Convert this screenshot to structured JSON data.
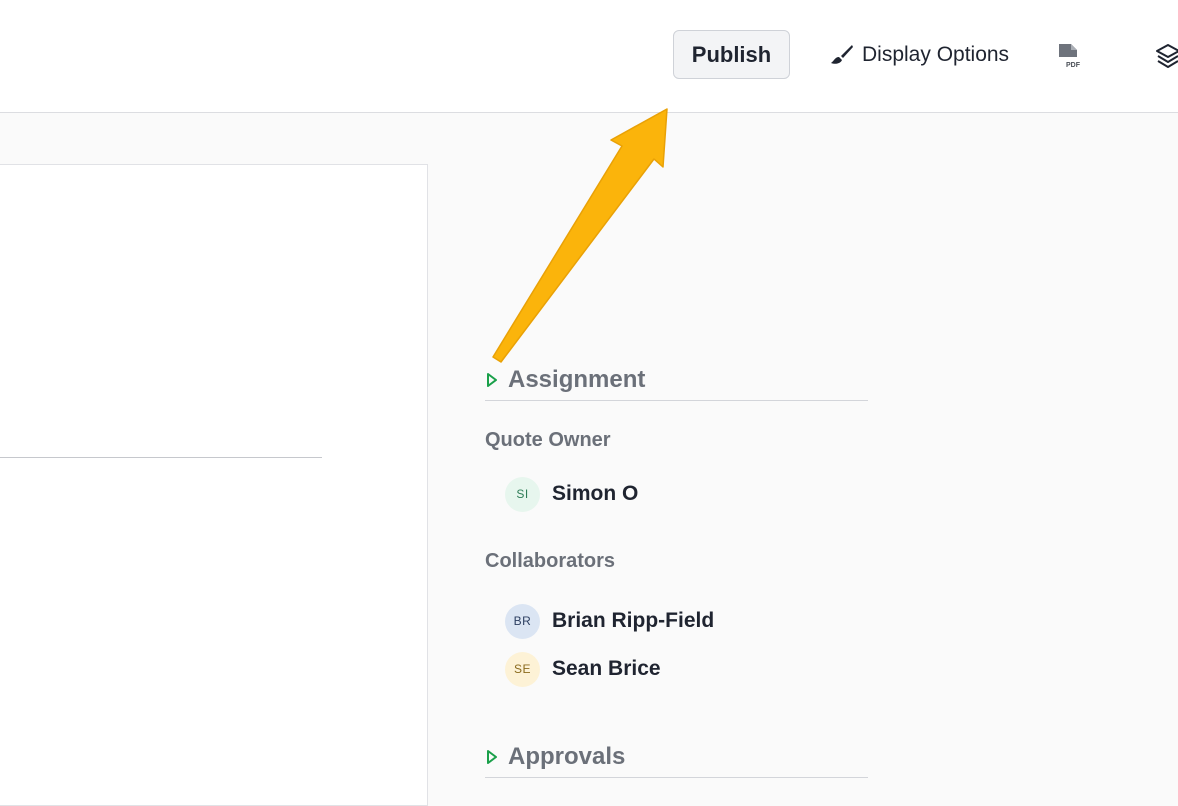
{
  "toolbar": {
    "publish_label": "Publish",
    "display_options_label": "Display Options",
    "pdf_icon_text": "PDF"
  },
  "assignment": {
    "title": "Assignment",
    "quote_owner_label": "Quote Owner",
    "owner": {
      "initials": "SI",
      "name": "Simon O",
      "bg": "#e7f6ee",
      "fg": "#2f7d57"
    },
    "collaborators_label": "Collaborators",
    "collaborators": [
      {
        "initials": "BR",
        "name": "Brian Ripp-Field",
        "bg": "#dbe5f3",
        "fg": "#2c3e60"
      },
      {
        "initials": "SE",
        "name": "Sean Brice",
        "bg": "#fdf2d6",
        "fg": "#8a6a1d"
      }
    ]
  },
  "approvals": {
    "title": "Approvals"
  },
  "colors": {
    "accent_caret": "#1aa04a",
    "annotation_arrow": "#fbb40b"
  },
  "icons": [
    "paintbrush-icon",
    "pdf-file-icon",
    "layers-icon",
    "caret-right-icon"
  ]
}
